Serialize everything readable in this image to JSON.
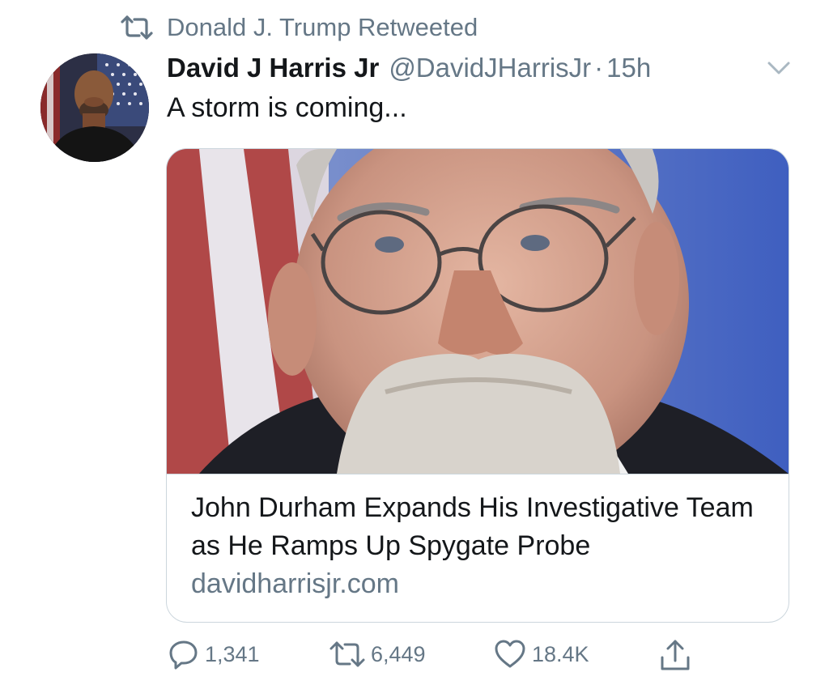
{
  "retweet_context": {
    "text": "Donald J. Trump Retweeted"
  },
  "tweet": {
    "display_name": "David J Harris Jr",
    "handle": "@DavidJHarrisJr",
    "separator": "·",
    "time": "15h",
    "text": "A storm is coming..."
  },
  "card": {
    "title": "John Durham Expands His Investigative Team as He Ramps Up Spygate Probe",
    "domain": "davidharrisjr.com"
  },
  "actions": {
    "reply_count": "1,341",
    "retweet_count": "6,449",
    "like_count": "18.4K"
  },
  "colors": {
    "text_primary": "#14171a",
    "text_secondary": "#657786",
    "border": "#ccd6dd"
  },
  "icons": {
    "retweet_context": "retweet-icon",
    "menu": "chevron-down-icon",
    "reply": "reply-icon",
    "retweet": "retweet-icon",
    "like": "heart-icon",
    "share": "share-icon"
  }
}
